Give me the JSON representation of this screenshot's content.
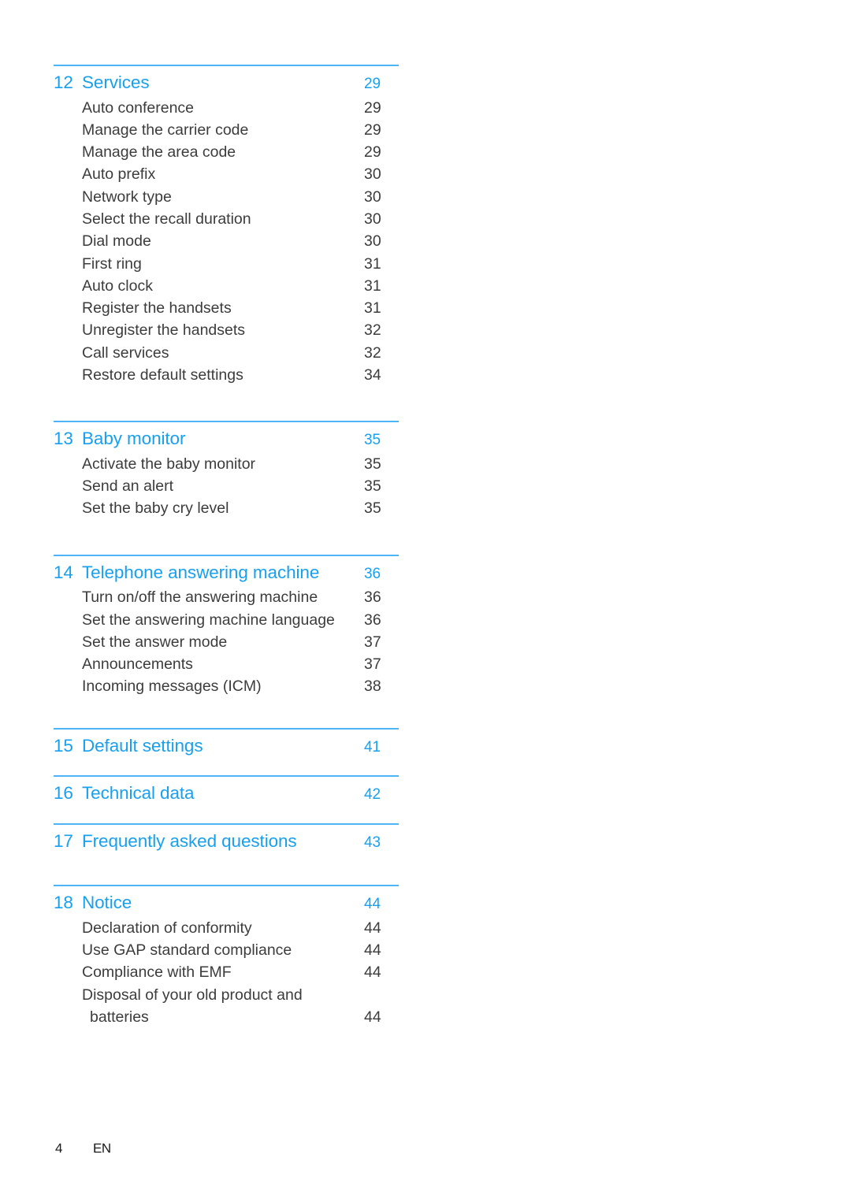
{
  "page": {
    "footer_page_number": "4",
    "footer_language": "EN",
    "accent_color": "#18a0f0",
    "rule_color": "#4db4f5",
    "body_text_color": "#3c3c3c"
  },
  "toc": {
    "groups": [
      {
        "number": "12",
        "title": "Services",
        "page": "29",
        "items": [
          {
            "label": "Auto conference",
            "page": "29"
          },
          {
            "label": "Manage the carrier code",
            "page": "29"
          },
          {
            "label": "Manage the area code",
            "page": "29"
          },
          {
            "label": "Auto prefix",
            "page": "30"
          },
          {
            "label": "Network type",
            "page": "30"
          },
          {
            "label": "Select the recall duration",
            "page": "30"
          },
          {
            "label": "Dial mode",
            "page": "30"
          },
          {
            "label": "First ring",
            "page": "31"
          },
          {
            "label": "Auto clock",
            "page": "31"
          },
          {
            "label": "Register the handsets",
            "page": "31"
          },
          {
            "label": "Unregister the handsets",
            "page": "32"
          },
          {
            "label": "Call services",
            "page": "32"
          },
          {
            "label": "Restore default settings",
            "page": "34"
          }
        ]
      },
      {
        "number": "13",
        "title": "Baby monitor",
        "page": "35",
        "items": [
          {
            "label": "Activate the baby monitor",
            "page": "35"
          },
          {
            "label": "Send an alert",
            "page": "35"
          },
          {
            "label": "Set the baby cry level",
            "page": "35"
          }
        ]
      },
      {
        "number": "14",
        "title": "Telephone answering machine",
        "page": "36",
        "items": [
          {
            "label": "Turn on/off the answering machine",
            "page": "36"
          },
          {
            "label": "Set the answering machine language",
            "page": "36"
          },
          {
            "label": "Set the answer mode",
            "page": "37"
          },
          {
            "label": "Announcements",
            "page": "37"
          },
          {
            "label": "Incoming messages (ICM)",
            "page": "38"
          }
        ]
      },
      {
        "number": "15",
        "title": "Default settings",
        "page": "41",
        "items": []
      },
      {
        "number": "16",
        "title": "Technical data",
        "page": "42",
        "items": []
      },
      {
        "number": "17",
        "title": "Frequently asked questions",
        "page": "43",
        "items": []
      },
      {
        "number": "18",
        "title": "Notice",
        "page": "44",
        "items": [
          {
            "label": "Declaration of conformity",
            "page": "44"
          },
          {
            "label": "Use GAP standard compliance",
            "page": "44"
          },
          {
            "label": "Compliance with EMF",
            "page": "44"
          },
          {
            "label": "Disposal of your old product and",
            "page": ""
          },
          {
            "label": "batteries",
            "page": "44",
            "continuation": true
          }
        ]
      }
    ]
  }
}
